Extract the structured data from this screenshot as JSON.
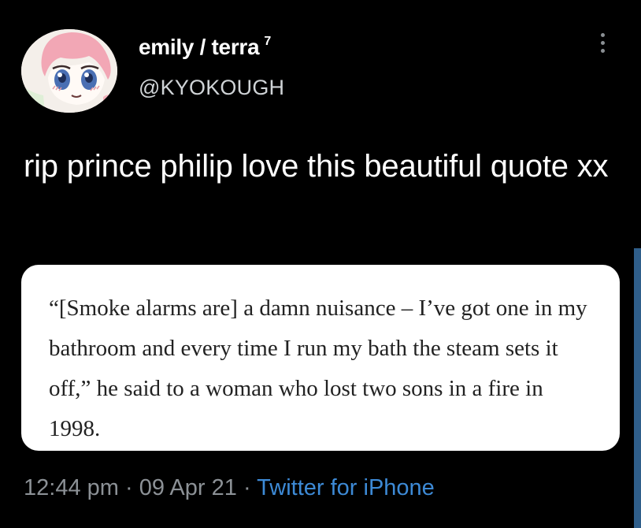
{
  "tweet": {
    "author": {
      "display_name": "emily / terra",
      "badge": "7",
      "handle": "@KYOKOUGH",
      "avatar_icon": "anime-avatar"
    },
    "more_icon": "more-vertical-icon",
    "text": "rip prince philip love this beautiful quote xx",
    "quote": {
      "text": "“[Smoke alarms are] a damn nuisance – I’ve got one in my bathroom and every time I run my bath the steam sets it off,” he said to a woman who lost two sons in a fire in 1998."
    },
    "meta": {
      "time": "12:44 pm",
      "separator": "·",
      "date": "09 Apr 21",
      "source": "Twitter for iPhone"
    },
    "colors": {
      "background": "#000000",
      "secondary_text": "#8c9196",
      "link": "#3d8ad6",
      "card": "#ffffff"
    }
  }
}
